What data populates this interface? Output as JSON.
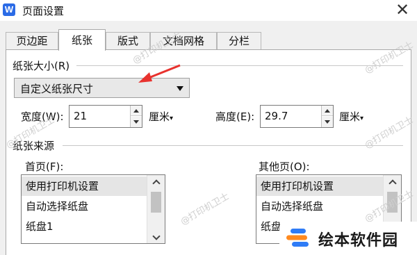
{
  "window": {
    "app_icon_letter": "W",
    "title": "页面设置",
    "close_glyph": "✕"
  },
  "tabs": [
    {
      "label": "页边距",
      "active": false
    },
    {
      "label": "纸张",
      "active": true
    },
    {
      "label": "版式",
      "active": false
    },
    {
      "label": "文档网格",
      "active": false
    },
    {
      "label": "分栏",
      "active": false
    }
  ],
  "paper_size": {
    "section_label": "纸张大小(R)",
    "selected": "自定义纸张尺寸"
  },
  "width": {
    "label": "宽度(W):",
    "value": "21",
    "unit": "厘米",
    "unit_arrow": "▾"
  },
  "height": {
    "label": "高度(E):",
    "value": "29.7",
    "unit": "厘米",
    "unit_arrow": "▾"
  },
  "paper_source": {
    "section_label": "纸张来源",
    "first_page": {
      "label": "首页(F):",
      "items": [
        "使用打印机设置",
        "自动选择纸盘",
        "纸盘1"
      ],
      "selected_index": 0
    },
    "other_pages": {
      "label": "其他页(O):",
      "items": [
        "使用打印机设置",
        "自动选择纸盘",
        "纸盘1"
      ],
      "selected_index": 0
    }
  },
  "watermark_text": "@打印机卫士",
  "logo": {
    "text": "绘本软件园"
  },
  "colors": {
    "accent_arrow": "#e8322e",
    "app_icon": "#2b6be6",
    "logo_blue": "#2f7cf6",
    "logo_orange": "#ff8a1f"
  }
}
